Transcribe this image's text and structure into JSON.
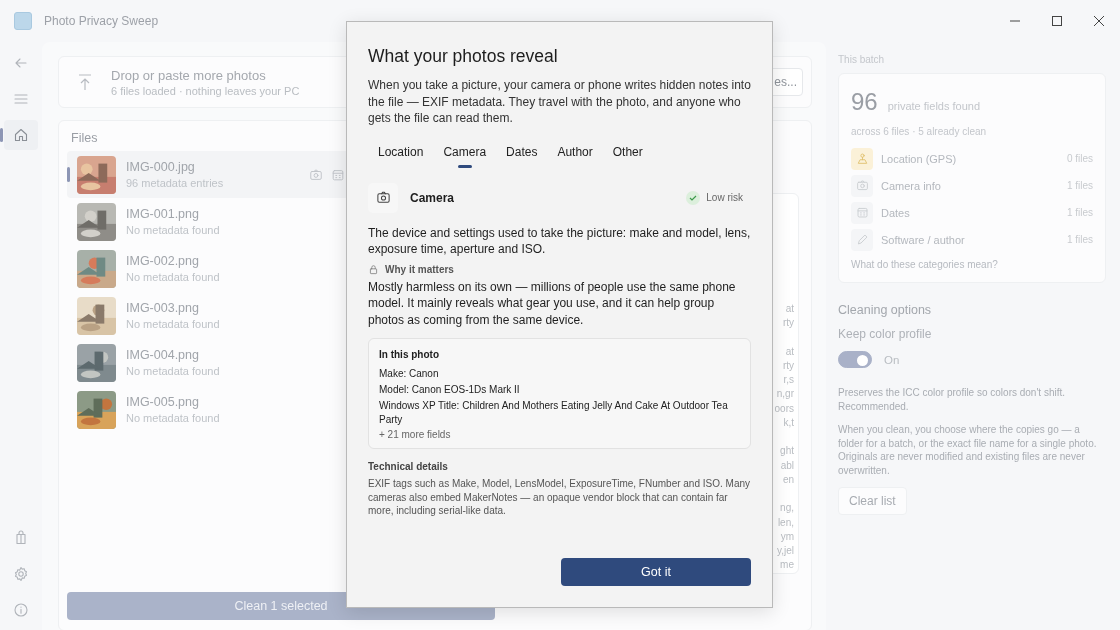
{
  "window": {
    "title": "Photo Privacy Sweep"
  },
  "nav": {
    "top": [
      {
        "kind": "back",
        "selected": false
      },
      {
        "kind": "menu",
        "selected": false
      },
      {
        "kind": "home",
        "selected": true
      }
    ],
    "bottom": [
      {
        "kind": "package"
      },
      {
        "kind": "settings"
      },
      {
        "kind": "info"
      }
    ]
  },
  "drop_zone": {
    "title": "Drop or paste more photos",
    "subtitle": "6 files loaded · nothing leaves your PC",
    "button": "es..."
  },
  "files": {
    "heading": "Files",
    "items": [
      {
        "name": "IMG-000.jpg",
        "detail": "96 metadata entries",
        "selected": true
      },
      {
        "name": "IMG-001.png",
        "detail": "No metadata found",
        "selected": false
      },
      {
        "name": "IMG-002.png",
        "detail": "No metadata found",
        "selected": false
      },
      {
        "name": "IMG-003.png",
        "detail": "No metadata found",
        "selected": false
      },
      {
        "name": "IMG-004.png",
        "detail": "No metadata found",
        "selected": false
      },
      {
        "name": "IMG-005.png",
        "detail": "No metadata found",
        "selected": false
      }
    ],
    "clean_button": "Clean 1 selected"
  },
  "detail_fragments": [
    [
      "at",
      "rty"
    ],
    [
      "at",
      "rty",
      "r,s",
      "n,gr",
      "oors",
      "k,t"
    ],
    [
      "ght",
      "abl",
      "en"
    ],
    [
      "ng,",
      "len,",
      "ym",
      "y,jel",
      "me"
    ]
  ],
  "batch": {
    "label": "This batch",
    "count": "96",
    "count_label": "private fields found",
    "summary": "across 6 files · 5 already clean",
    "categories": [
      {
        "kind": "location",
        "label": "Location (GPS)",
        "value": "0 files",
        "highlighted": true
      },
      {
        "kind": "camera",
        "label": "Camera info",
        "value": "1 files",
        "highlighted": false
      },
      {
        "kind": "dates",
        "label": "Dates",
        "value": "1 files",
        "highlighted": false
      },
      {
        "kind": "software",
        "label": "Software / author",
        "value": "1 files",
        "highlighted": false
      }
    ],
    "link": "What do these categories mean?"
  },
  "cleaning": {
    "heading": "Cleaning options",
    "option": "Keep color profile",
    "toggle": {
      "label": "On",
      "on": true
    },
    "notes": [
      "Preserves the ICC color profile so colors don't shift. Recommended.",
      "When you clean, you choose where the copies go — a folder for a batch, or the exact file name for a single photo. Originals are never modified and existing files are never overwritten."
    ],
    "button": "Clear list"
  },
  "dialog": {
    "title": "What your photos reveal",
    "intro": "When you take a picture, your camera or phone writes hidden notes into the file — EXIF metadata. They travel with the photo, and anyone who gets the file can read them.",
    "tabs": [
      {
        "label": "Location",
        "selected": false
      },
      {
        "label": "Camera",
        "selected": true
      },
      {
        "label": "Dates",
        "selected": false
      },
      {
        "label": "Author",
        "selected": false
      },
      {
        "label": "Other",
        "selected": false
      }
    ],
    "section": {
      "title": "Camera",
      "risk": "Low risk"
    },
    "description": "The device and settings used to take the picture: make and model, lens, exposure time, aperture and ISO.",
    "why_heading": "Why it matters",
    "why_text": "Mostly harmless on its own — millions of people use the same phone model. It mainly reveals what gear you use, and it can help group photos as coming from the same device.",
    "in_photo": {
      "heading": "In this photo",
      "fields": [
        "Make: Canon",
        "Model: Canon EOS-1Ds Mark II",
        "Windows XP Title: Children And Mothers Eating Jelly And Cake At Outdoor Tea Party"
      ],
      "more": "+ 21 more fields"
    },
    "technical_heading": "Technical details",
    "technical_text": "EXIF tags such as Make, Model, LensModel, ExposureTime, FNumber and ISO. Many cameras also embed MakerNotes — an opaque vendor block that can contain far more, including serial-like data.",
    "button": "Got it"
  }
}
